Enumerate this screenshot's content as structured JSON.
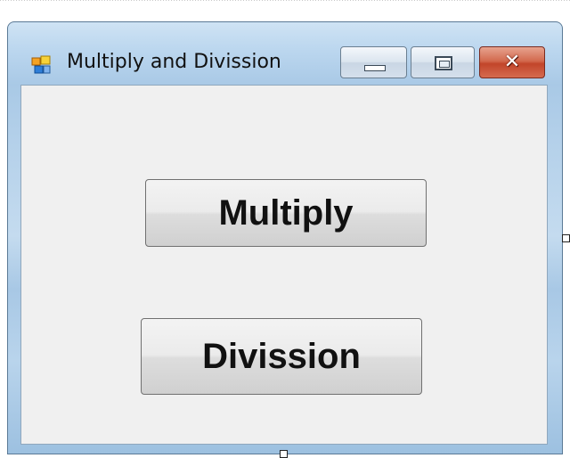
{
  "window": {
    "title": "Multiply and Divission",
    "icon": "windows-form-icon",
    "controls": {
      "minimize_icon": "minimize-icon",
      "maximize_icon": "maximize-icon",
      "close_icon": "close-icon",
      "close_glyph": "✕"
    }
  },
  "form": {
    "multiply_label": "Multiply",
    "division_label": "Divission"
  },
  "colors": {
    "close_button": "#c2452a",
    "form_background": "#f0f0f0",
    "titlebar_tint": "#bcd7ef"
  }
}
